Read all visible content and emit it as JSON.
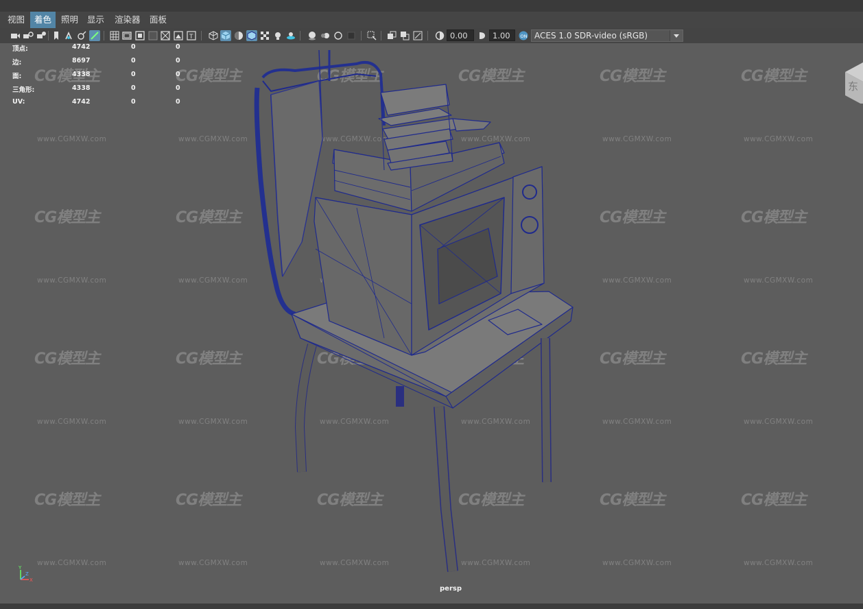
{
  "menubar": {
    "items": [
      "视图",
      "着色",
      "照明",
      "显示",
      "渲染器",
      "面板"
    ],
    "active_index": 1
  },
  "toolbar": {
    "exposure_value": "0.00",
    "gamma_value": "1.00",
    "color_space": "ACES 1.0 SDR-video (sRGB)"
  },
  "hud": {
    "rows": [
      {
        "label": "顶点:",
        "v1": "4742",
        "v2": "0",
        "v3": "0"
      },
      {
        "label": "边:",
        "v1": "8697",
        "v2": "0",
        "v3": "0"
      },
      {
        "label": "面:",
        "v1": "4338",
        "v2": "0",
        "v3": "0"
      },
      {
        "label": "三角形:",
        "v1": "4338",
        "v2": "0",
        "v3": "0"
      },
      {
        "label": "UV:",
        "v1": "4742",
        "v2": "0",
        "v3": "0"
      }
    ]
  },
  "viewport": {
    "camera_label": "persp",
    "viewcube_label": "东",
    "axis_labels": {
      "x": "X",
      "y": "Y",
      "z": "Z"
    }
  },
  "watermark": {
    "logo_text": "CG模型主",
    "url_text": "www.CGMXW.com"
  },
  "colors": {
    "viewport_bg": "#5d5d5d",
    "wireframe": "#1f2a8c",
    "menu_active": "#5285a6"
  }
}
